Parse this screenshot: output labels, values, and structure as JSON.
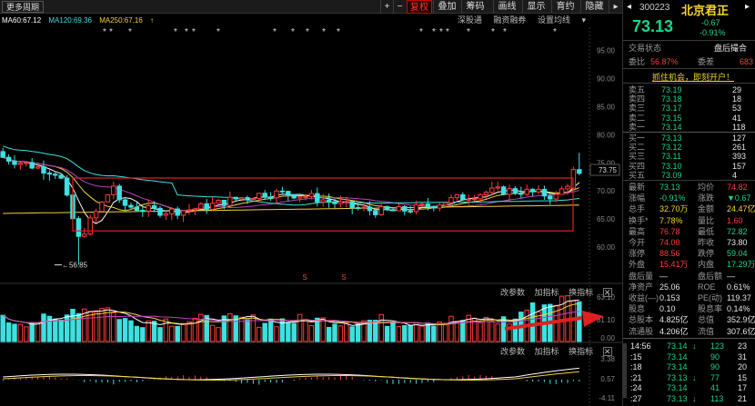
{
  "toolbar": {
    "more_period": "更多周期",
    "buttons": [
      "+",
      "−",
      "复权",
      "叠加",
      "画线",
      "画线",
      "显示",
      "育约",
      "隐藏"
    ],
    "fuquan": "复权",
    "diejia": "叠加",
    "chouma": "筹码",
    "huaxian": "画线",
    "xianshi": "显示",
    "yuyue": "育约",
    "yincang": "隐藏"
  },
  "ma_legend": {
    "ma60": "MA60:67.12",
    "ma120": "MA120:69.36",
    "ma250": "MA250:67.16"
  },
  "subbar": {
    "item1": "深股通",
    "item2": "融资融券",
    "item3": "设置均线"
  },
  "price_axis": {
    "labels": [
      "95.00",
      "90.00",
      "85.00",
      "80.00",
      "75.00",
      "70.00",
      "65.00",
      "60.00"
    ],
    "current_price_label": "73.75",
    "low_annotation": "56.85"
  },
  "volume_panel": {
    "bar_items": [
      "改参数",
      "加指标",
      "换指标"
    ],
    "close": "✕",
    "axis_labels": [
      "63.10",
      "81.10",
      "0.00"
    ]
  },
  "macd_panel": {
    "bar_items": [
      "改参数",
      "加指标",
      "换指标"
    ],
    "close": "✕",
    "axis_labels": [
      "3.38",
      "0.57",
      "-4.11"
    ]
  },
  "markers": {
    "s_label": "S"
  },
  "quote": {
    "code": "300223",
    "name": "北京君正",
    "price": "73.13",
    "change": "-0.67",
    "change_pct": "-0.91%",
    "status_label": "交易状态",
    "status_value": "盘后撮合",
    "weibi_label": "委比",
    "weibi_value": "56.87%",
    "weicha_label": "委差",
    "weicha_value": "683",
    "promo": "抓住机会，即刻开户！"
  },
  "asks": [
    {
      "label": "卖五",
      "price": "73.19",
      "vol": "29"
    },
    {
      "label": "卖四",
      "price": "73.18",
      "vol": "18"
    },
    {
      "label": "卖三",
      "price": "73.17",
      "vol": "53"
    },
    {
      "label": "卖二",
      "price": "73.15",
      "vol": "41"
    },
    {
      "label": "卖一",
      "price": "73.14",
      "vol": "118"
    }
  ],
  "bids": [
    {
      "label": "买一",
      "price": "73.13",
      "vol": "127"
    },
    {
      "label": "买二",
      "price": "73.12",
      "vol": "261"
    },
    {
      "label": "买三",
      "price": "73.11",
      "vol": "393"
    },
    {
      "label": "买四",
      "price": "73.10",
      "vol": "157"
    },
    {
      "label": "买五",
      "price": "73.09",
      "vol": "4"
    }
  ],
  "stats": [
    {
      "l1": "最新",
      "v1": "73.13",
      "c1": "down",
      "l2": "均价",
      "v2": "74.82",
      "c2": "up"
    },
    {
      "l1": "涨幅",
      "v1": "-0.91%",
      "c1": "down",
      "l2": "涨跌",
      "v2": "▼0.67",
      "c2": "down"
    },
    {
      "l1": "总手",
      "v1": "32.70万",
      "c1": "yel",
      "l2": "金额",
      "v2": "24.47亿",
      "c2": "yel"
    },
    {
      "l1": "换手*",
      "v1": "7.78%",
      "c1": "yel",
      "l2": "量比",
      "v2": "1.60",
      "c2": "up"
    },
    {
      "l1": "最高",
      "v1": "76.78",
      "c1": "up",
      "l2": "最低",
      "v2": "72.82",
      "c2": "down"
    },
    {
      "l1": "今开",
      "v1": "74.00",
      "c1": "up",
      "l2": "昨收",
      "v2": "73.80",
      "c2": "wht"
    },
    {
      "l1": "涨停",
      "v1": "88.56",
      "c1": "up",
      "l2": "跌停",
      "v2": "59.04",
      "c2": "down"
    },
    {
      "l1": "外盘",
      "v1": "15.41万",
      "c1": "up",
      "l2": "内盘",
      "v2": "17.29万",
      "c2": "down"
    },
    {
      "l1": "盘后量",
      "v1": "—",
      "c1": "wht",
      "l2": "盘后额",
      "v2": "—",
      "c2": "wht"
    },
    {
      "l1": "净资产",
      "v1": "25.06",
      "c1": "wht",
      "l2": "ROE",
      "v2": "0.61%",
      "c2": "wht"
    },
    {
      "l1": "收益(—)",
      "v1": "0.153",
      "c1": "wht",
      "l2": "PE(动)",
      "v2": "119.37",
      "c2": "wht"
    },
    {
      "l1": "股息",
      "v1": "0.10",
      "c1": "wht",
      "l2": "股息率",
      "v2": "0.14%",
      "c2": "wht"
    },
    {
      "l1": "总股本",
      "v1": "4.825亿",
      "c1": "wht",
      "l2": "总值",
      "v2": "352.9亿",
      "c2": "wht"
    },
    {
      "l1": "流通股",
      "v1": "4.206亿",
      "c1": "wht",
      "l2": "流值",
      "v2": "307.6亿",
      "c2": "wht"
    }
  ],
  "ticks": [
    {
      "time": "14:56",
      "price": "73.14",
      "arrow": "↓",
      "vol": "123",
      "n": "23"
    },
    {
      "time": ":15",
      "price": "73.14",
      "arrow": "",
      "vol": "90",
      "n": "31"
    },
    {
      "time": ":18",
      "price": "73.14",
      "arrow": "",
      "vol": "90",
      "n": "20"
    },
    {
      "time": ":21",
      "price": "73.13",
      "arrow": "↓",
      "vol": "77",
      "n": "15"
    },
    {
      "time": ":24",
      "price": "73.14",
      "arrow": "",
      "vol": "41",
      "n": "17"
    },
    {
      "time": ":27",
      "price": "73.13",
      "arrow": "↓",
      "vol": "113",
      "n": "21"
    }
  ],
  "colors": {
    "up": "#ff3b3b",
    "down": "#19d58b",
    "ma60": "#ffffff",
    "ma120": "#3ee0e0",
    "ma250": "#f0d23c",
    "ma_extra": "#c040c0",
    "box": "#e02020"
  }
}
